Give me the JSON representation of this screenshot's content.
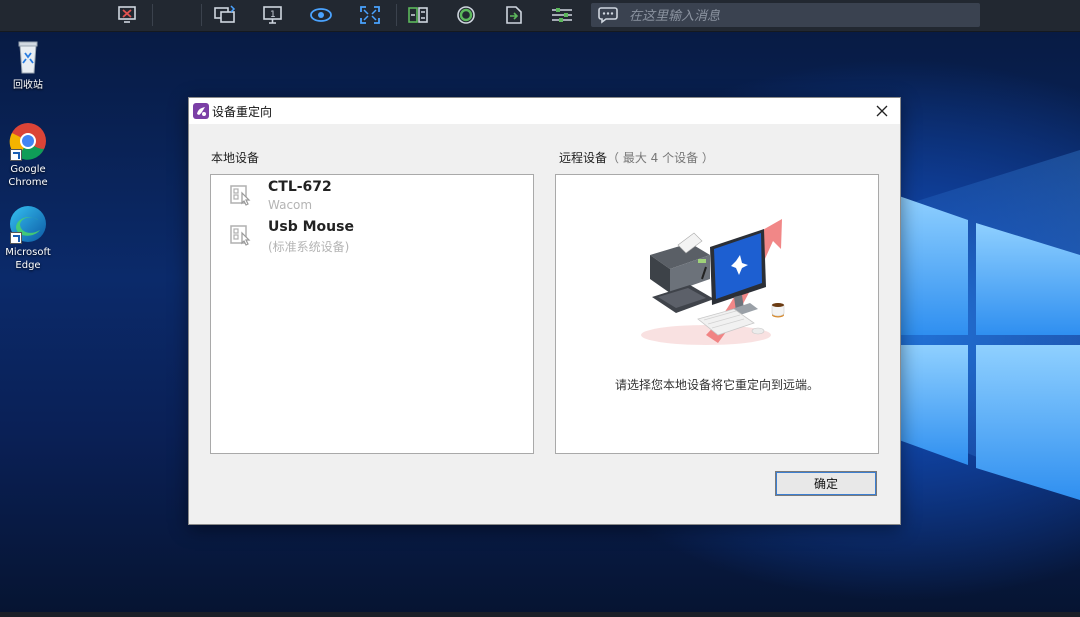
{
  "toolbar": {
    "icons": [
      "remote-desktop-close-icon",
      "switch-screen-icon",
      "monitor-icon",
      "view-icon",
      "fullscreen-icon",
      "file-transfer-icon",
      "record-icon",
      "device-redirect-icon",
      "settings-icon",
      "chat-icon"
    ],
    "chat_placeholder": "在这里输入消息"
  },
  "desktop": {
    "icons": [
      {
        "label": "回收站",
        "icon": "recycle-bin-icon"
      },
      {
        "label": "Google Chrome",
        "icon": "chrome-icon"
      },
      {
        "label": "Microsoft Edge",
        "icon": "edge-icon"
      }
    ]
  },
  "dialog": {
    "title": "设备重定向",
    "local_label": "本地设备",
    "remote_label": "远程设备",
    "remote_hint": "（ 最大 4 个设备 ）",
    "devices": [
      {
        "name": "CTL-672",
        "sub": "Wacom"
      },
      {
        "name": "Usb Mouse",
        "sub": "(标准系统设备)"
      }
    ],
    "remote_message": "请选择您本地设备将它重定向到远端。",
    "ok_label": "确定"
  },
  "colors": {
    "toolbar_bg": "#222831",
    "toolbar_icon": "#cfd6df",
    "toolbar_accent_green": "#5cb85c",
    "dialog_bg": "#f0f0f0",
    "arrow_red": "#ef7a7a"
  }
}
